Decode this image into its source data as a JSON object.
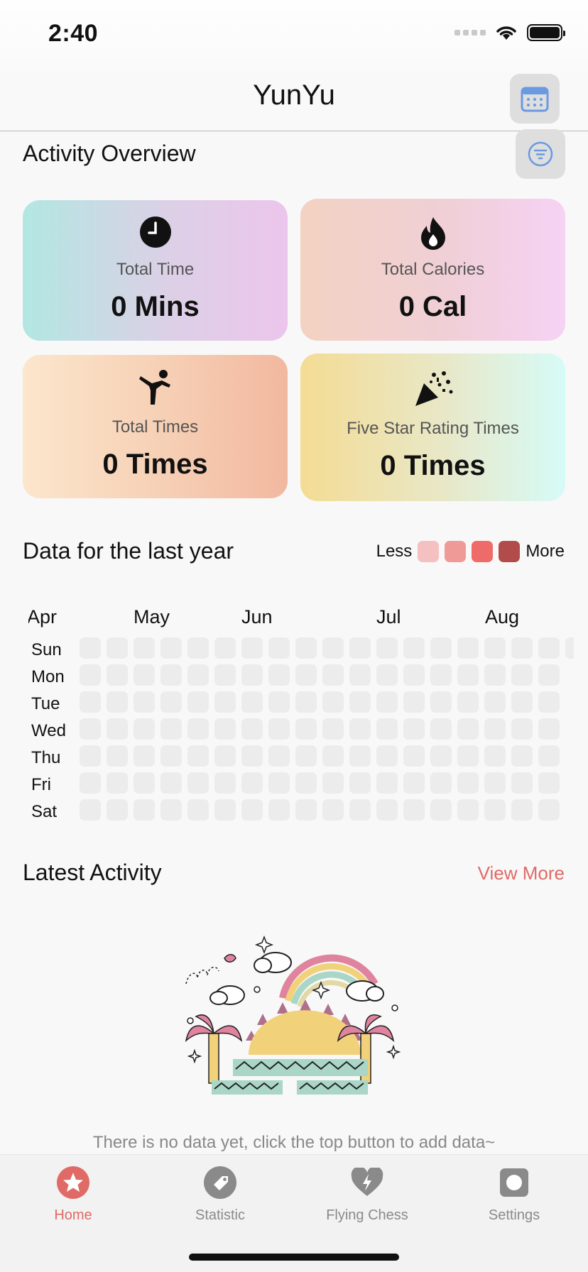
{
  "status": {
    "time": "2:40"
  },
  "nav": {
    "title": "YunYu"
  },
  "overview": {
    "title": "Activity Overview",
    "cards": [
      {
        "label": "Total Time",
        "value": "0 Mins",
        "icon": "clock-icon"
      },
      {
        "label": "Total Calories",
        "value": "0 Cal",
        "icon": "flame-icon"
      },
      {
        "label": "Total Times",
        "value": "0 Times",
        "icon": "exercise-icon"
      },
      {
        "label": "Five Star Rating Times",
        "value": "0 Times",
        "icon": "party-popper-icon"
      }
    ]
  },
  "heatmap": {
    "title": "Data for the last year",
    "legend": {
      "less": "Less",
      "more": "More",
      "colors": [
        "#f4c0c0",
        "#f09a98",
        "#ee6b69",
        "#b24c4a"
      ]
    },
    "months": [
      "Apr",
      "May",
      "Jun",
      "Jul",
      "Aug"
    ],
    "days": [
      "Sun",
      "Mon",
      "Tue",
      "Wed",
      "Thu",
      "Fri",
      "Sat"
    ],
    "empty_color": "#ececec"
  },
  "latest": {
    "title": "Latest Activity",
    "view_more": "View More",
    "empty_text": "There is no data yet, click the top button to add data~"
  },
  "tabs": [
    {
      "label": "Home",
      "active": true,
      "icon": "star-icon"
    },
    {
      "label": "Statistic",
      "active": false,
      "icon": "tag-icon"
    },
    {
      "label": "Flying Chess",
      "active": false,
      "icon": "heart-bolt-icon"
    },
    {
      "label": "Settings",
      "active": false,
      "icon": "gear-icon"
    }
  ],
  "colors": {
    "accent": "#e06a66",
    "button_bg": "#dedede",
    "icon_blue": "#6a9ae0"
  }
}
